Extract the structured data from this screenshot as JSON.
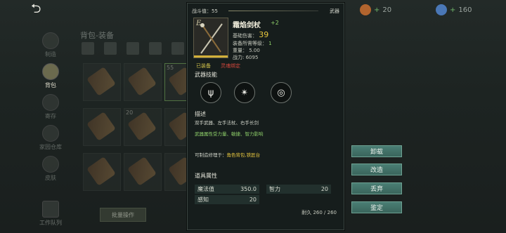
{
  "topbar": {
    "currency_1": "20",
    "currency_2": "160"
  },
  "nav": {
    "items": [
      {
        "label": "制造",
        "active": false
      },
      {
        "label": "背包",
        "active": true
      },
      {
        "label": "寄存",
        "active": false
      },
      {
        "label": "家园仓库",
        "active": false
      },
      {
        "label": "皮肤",
        "active": false
      }
    ],
    "work_queue": "工作队列"
  },
  "bag": {
    "title": "背包-装备",
    "slots": [
      {
        "count": ""
      },
      {
        "count": ""
      },
      {
        "count": "55"
      },
      {
        "count": ""
      },
      {
        "count": "20"
      },
      {
        "count": ""
      },
      {
        "count": ""
      },
      {
        "count": ""
      },
      {
        "count": ""
      },
      {
        "count": ""
      },
      {
        "count": ""
      },
      {
        "count": ""
      }
    ],
    "sell_label": "批量操作"
  },
  "panel": {
    "gear_score_label": "战斗值：55",
    "category": "武器",
    "icon_letter": "E",
    "name": "霜焰剑杖",
    "upgrade": "+2",
    "base_damage_label": "基础伤害：",
    "base_damage": "39",
    "equip_level_label": "装备所需等级：",
    "equip_level": "1",
    "weight": "重量： 5.00",
    "power": "战力: 6095",
    "equipped": "已装备",
    "bound": "灵魂绑定",
    "skills_title": "武器技能",
    "skills": [
      {
        "icon": "trident-icon",
        "glyph": "ψ"
      },
      {
        "icon": "staff-icon",
        "glyph": "✴"
      },
      {
        "icon": "vortex-icon",
        "glyph": "◎"
      }
    ],
    "desc_title": "描述",
    "desc": "双手武器、左手法杖、右手长剑",
    "attr_note": "武器属性受力量、敏捷、智力影响",
    "repair_label": "可制造修理于：",
    "repair_value": "角色背包,铁匠台",
    "attr_title": "道具属性",
    "attrs": [
      {
        "name": "魔法值",
        "value": "350.0"
      },
      {
        "name": "智力",
        "value": "20"
      },
      {
        "name": "感知",
        "value": "20"
      }
    ],
    "durability": "耐久 260 / 260"
  },
  "actions": {
    "unequip": "卸载",
    "modify": "改造",
    "discard": "丢弃",
    "identify": "鉴定"
  },
  "colors": {
    "accent_gold": "#e9c83f",
    "accent_green": "#8fd06a",
    "action_teal": "#4a7e74"
  }
}
